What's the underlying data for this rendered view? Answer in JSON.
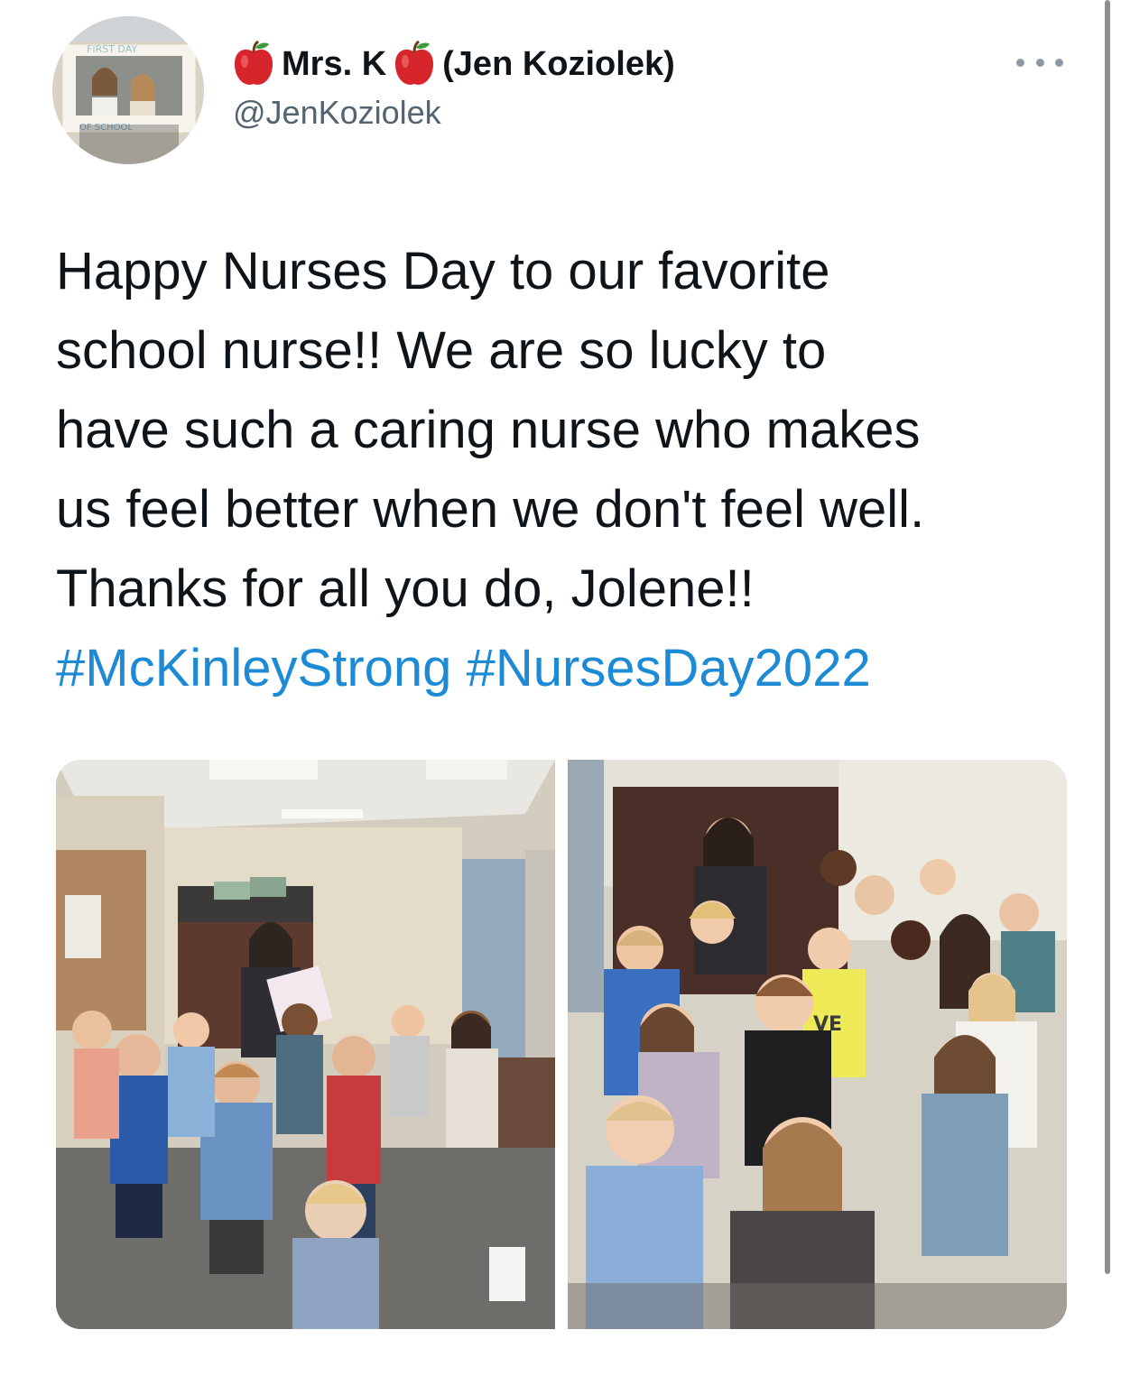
{
  "author": {
    "name_part1": "Mrs. K",
    "name_part2": "(Jen Koziolek)",
    "handle": "@JenKoziolek",
    "emoji_icon": "red-apple-icon",
    "avatar_sign_text": "FIRST DAY",
    "avatar_sign_text2": "OF SCHOOL"
  },
  "tweet": {
    "lines": [
      "Happy Nurses Day to our favorite",
      "school nurse!! We are so lucky to",
      "have such a caring nurse who makes",
      "us feel better when we don't feel well.",
      "Thanks for all you do, Jolene!!"
    ],
    "hashtag1": "#McKinleyStrong",
    "hashtag2": "#NursesDay2022"
  },
  "media": {
    "count": 2,
    "photo1_shirt_text": "",
    "photo2_shirt_text": "VE"
  },
  "colors": {
    "hashtag": "#1d8ad6",
    "handle": "#536471",
    "text": "#0f1419"
  }
}
